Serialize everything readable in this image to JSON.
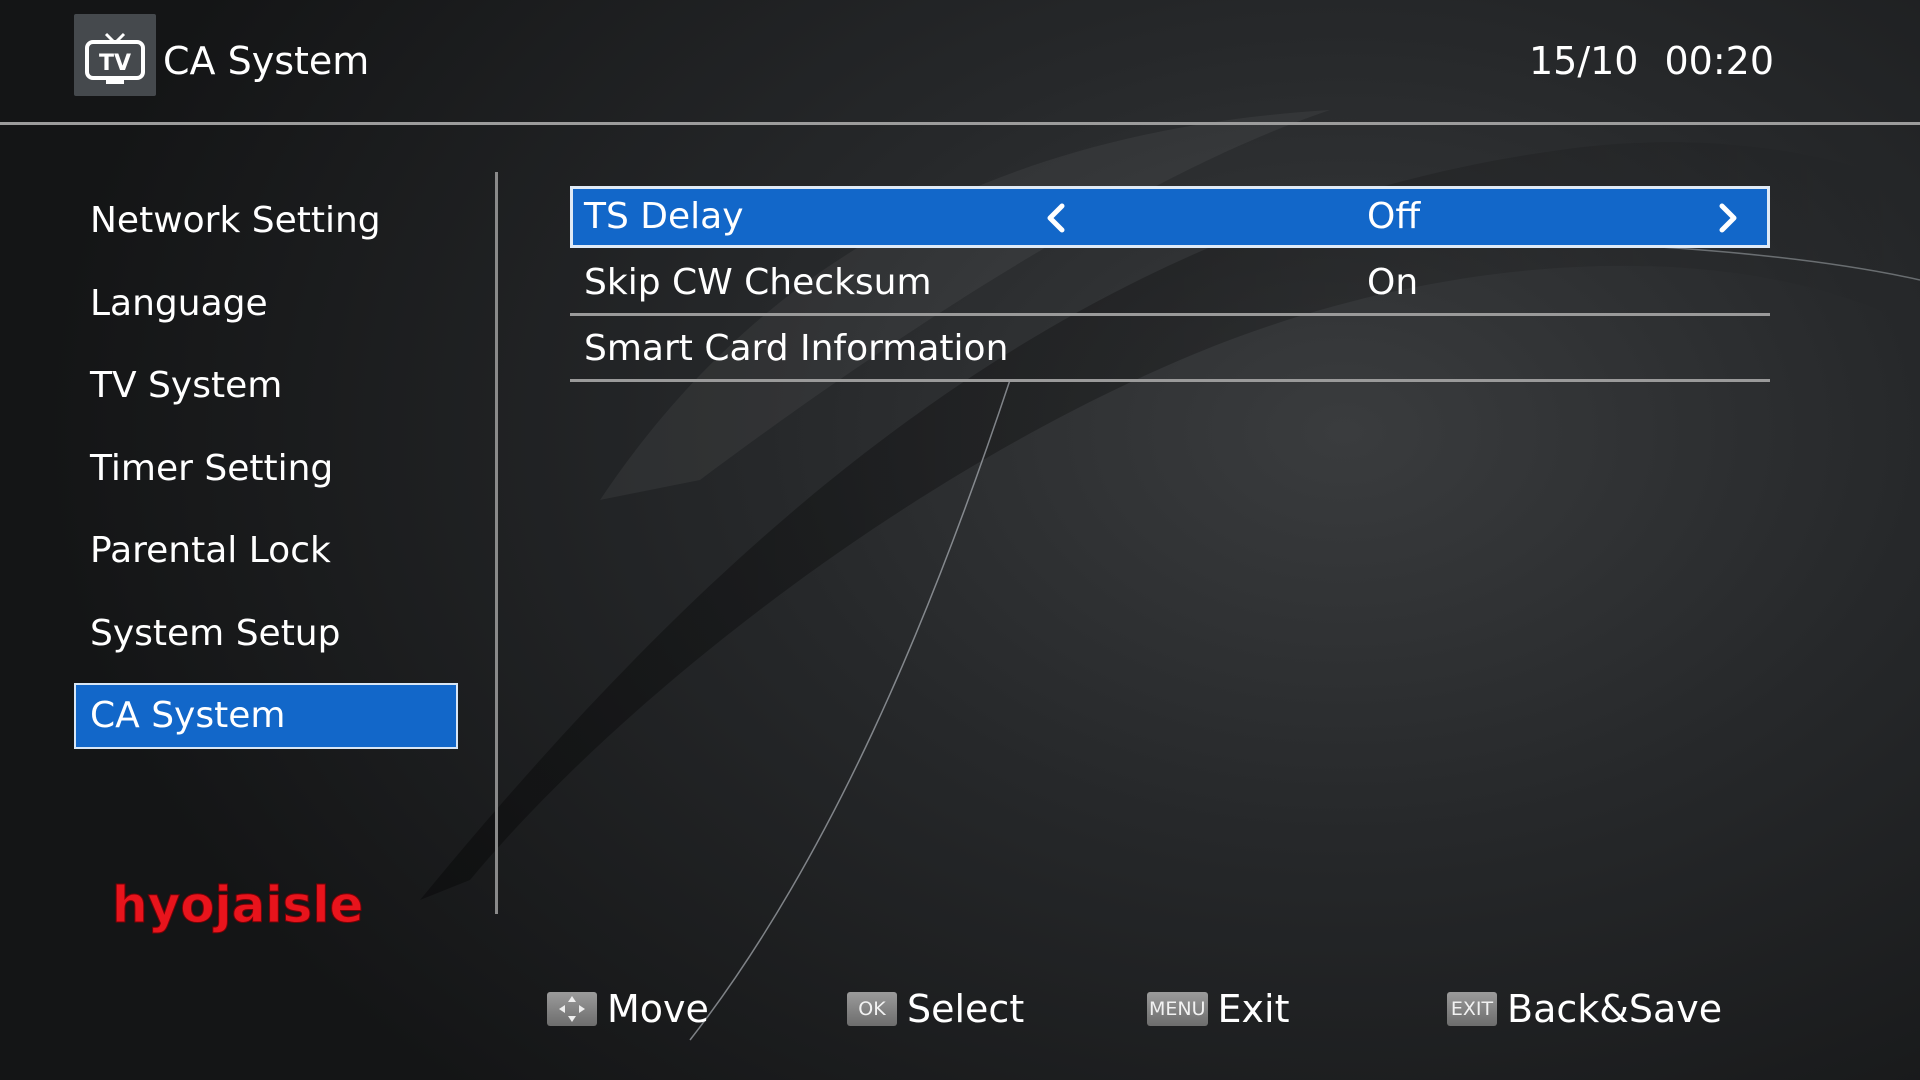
{
  "header": {
    "title": "CA System",
    "date": "15/10",
    "time": "00:20",
    "icon": "tv-icon"
  },
  "sidebar": {
    "items": [
      {
        "label": "Network Setting",
        "active": false
      },
      {
        "label": "Language",
        "active": false
      },
      {
        "label": "TV System",
        "active": false
      },
      {
        "label": "Timer Setting",
        "active": false
      },
      {
        "label": "Parental Lock",
        "active": false
      },
      {
        "label": "System Setup",
        "active": false
      },
      {
        "label": "CA System",
        "active": true
      }
    ]
  },
  "settings": {
    "rows": [
      {
        "label": "TS Delay",
        "value": "Off",
        "selected": true
      },
      {
        "label": "Skip CW Checksum",
        "value": "On",
        "selected": false
      },
      {
        "label": "Smart Card Information",
        "value": "",
        "selected": false
      }
    ]
  },
  "watermark": {
    "text": "hyojaisle",
    "color": "#e8141c"
  },
  "footer": {
    "items": [
      {
        "key": "",
        "key_icon": "move-arrows-icon",
        "label": "Move"
      },
      {
        "key": "OK",
        "label": "Select"
      },
      {
        "key": "MENU",
        "label": "Exit"
      },
      {
        "key": "EXIT",
        "label": "Back&Save"
      }
    ]
  },
  "colors": {
    "accent": "#1267c9",
    "divider": "#9c9c9c",
    "text": "#ffffff"
  }
}
